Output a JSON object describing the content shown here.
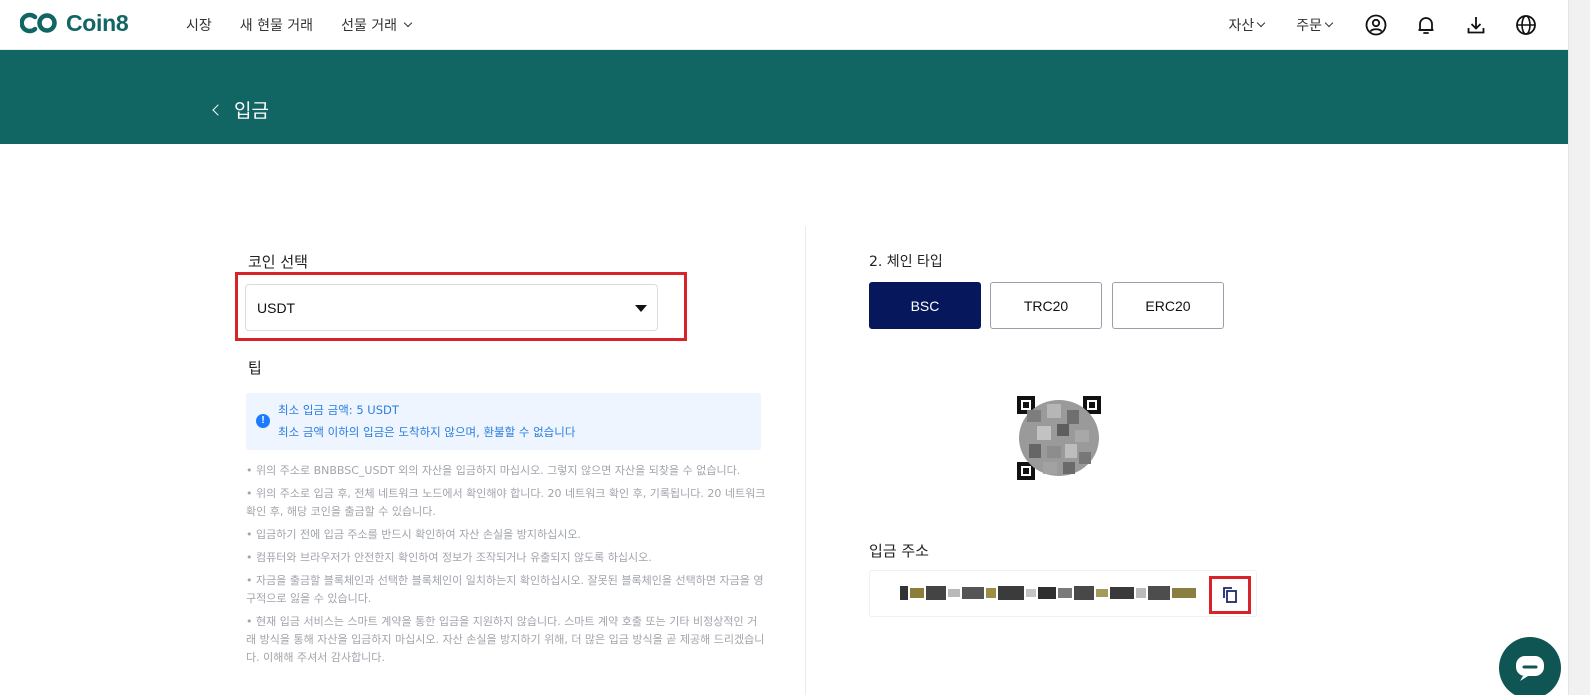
{
  "brand": {
    "name": "Coin8",
    "color": "#116563"
  },
  "nav": {
    "items": [
      {
        "label": "시장"
      },
      {
        "label": "새 현물 거래"
      },
      {
        "label": "선물 거래"
      }
    ],
    "right": {
      "assets_label": "자산",
      "orders_label": "주문"
    },
    "icons": [
      "user-circle-icon",
      "bell-icon",
      "download-icon",
      "globe-icon"
    ]
  },
  "page": {
    "title": "입금"
  },
  "coin": {
    "label": "코인 선택",
    "selected": "USDT"
  },
  "tips": {
    "title": "팁",
    "notice_line1": "최소 입금 금액: 5 USDT",
    "notice_line2": "최소 금액 이하의 입금은 도착하지 않으며, 환불할 수 없습니다",
    "items": [
      "• 위의 주소로 BNBBSC_USDT 외의 자산을 입금하지 마십시오. 그렇지 않으면 자산을 되찾을 수 없습니다.",
      "• 위의 주소로 입금 후, 전체 네트워크 노드에서 확인해야 합니다. 20 네트워크 확인 후, 기록됩니다. 20 네트워크 확인 후, 해당 코인을 출금할 수 있습니다.",
      "• 입금하기 전에 입금 주소를 반드시 확인하여 자산 손실을 방지하십시오.",
      "• 컴퓨터와 브라우저가 안전한지 확인하여 정보가 조작되거나 유출되지 않도록 하십시오.",
      "• 자금을 출금할 블록체인과 선택한 블록체인이 일치하는지 확인하십시오. 잘못된 블록체인을 선택하면 자금을 영구적으로 잃을 수 있습니다.",
      "• 현재 입금 서비스는 스마트 계약을 통한 입금을 지원하지 않습니다. 스마트 계약 호출 또는 기타 비정상적인 거래 방식을 통해 자산을 입금하지 마십시오. 자산 손실을 방지하기 위해, 더 많은 입금 방식을 곧 제공해 드리겠습니다. 이해해 주셔서 감사합니다."
    ]
  },
  "chain": {
    "label": "2. 체인 타입",
    "options": [
      {
        "label": "BSC",
        "active": true
      },
      {
        "label": "TRC20",
        "active": false
      },
      {
        "label": "ERC20",
        "active": false
      }
    ],
    "active_color": "#06185b"
  },
  "address": {
    "label": "입금 주소"
  },
  "colors": {
    "banner": "#116563",
    "highlight": "#d8232a",
    "notice_text": "#2a7de1"
  }
}
